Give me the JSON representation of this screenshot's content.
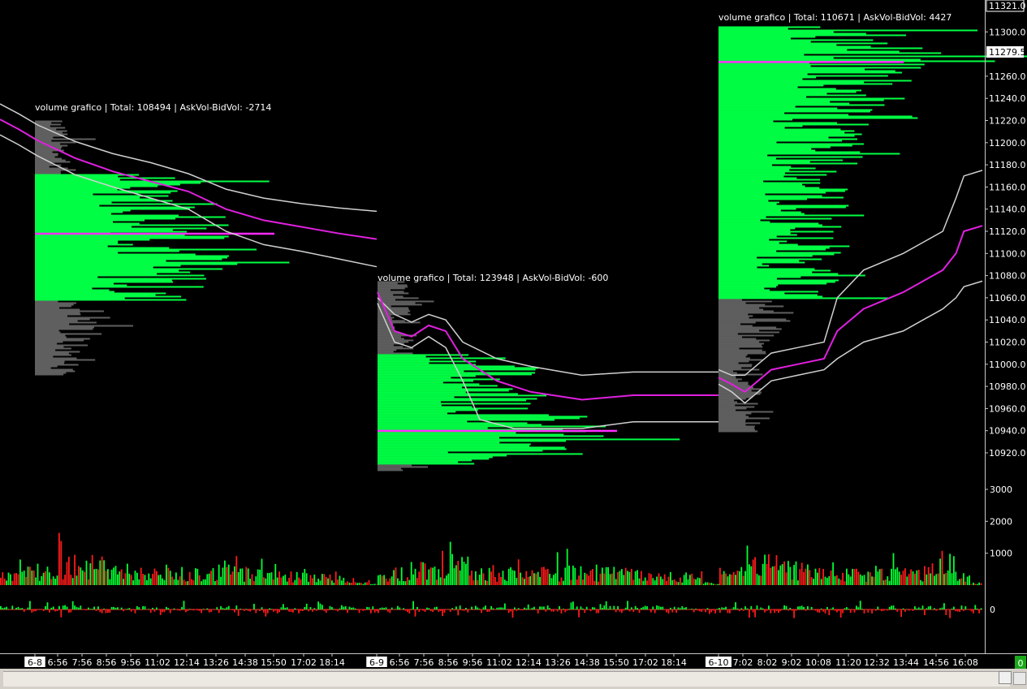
{
  "chart_data": {
    "type": "volume_profile",
    "price_axis": {
      "ticks": [
        10920,
        10940,
        10960,
        10980,
        11000,
        11020,
        11040,
        11060,
        11080,
        11100,
        11120,
        11140,
        11160,
        11180,
        11200,
        11220,
        11240,
        11260,
        11300
      ],
      "tick_labels": [
        "10920.0",
        "10940.0",
        "10960.0",
        "10980.0",
        "11000.0",
        "11020.0",
        "11040.0",
        "11060.0",
        "11080.0",
        "11100.0",
        "11120.0",
        "11140.0",
        "11160.0",
        "11180.0",
        "11200.0",
        "11220.0",
        "11240.0",
        "11260.0",
        "11300.0"
      ],
      "current_price_label": "11279.5",
      "top_price_label": "11321.0",
      "range": [
        10905,
        11325
      ]
    },
    "volume_axis": {
      "ticks": [
        1000,
        2000,
        3000
      ],
      "tick_labels": [
        "1000",
        "2000",
        "3000"
      ],
      "range": [
        0,
        3000
      ]
    },
    "delta_axis": {
      "ticks": [
        0
      ],
      "tick_labels": [
        "0"
      ]
    },
    "time_axis": [
      {
        "label": "6-8",
        "boxed": true
      },
      {
        "label": "6:56"
      },
      {
        "label": "7:56"
      },
      {
        "label": "8:56"
      },
      {
        "label": "9:56"
      },
      {
        "label": "11:02"
      },
      {
        "label": "12:14"
      },
      {
        "label": "13:26"
      },
      {
        "label": "14:38"
      },
      {
        "label": "15:50"
      },
      {
        "label": "17:02"
      },
      {
        "label": "18:14"
      },
      {
        "label": "6-9",
        "boxed": true
      },
      {
        "label": "6:56"
      },
      {
        "label": "7:56"
      },
      {
        "label": "8:56"
      },
      {
        "label": "9:56"
      },
      {
        "label": "11:02"
      },
      {
        "label": "12:14"
      },
      {
        "label": "13:26"
      },
      {
        "label": "14:38"
      },
      {
        "label": "15:50"
      },
      {
        "label": "17:02"
      },
      {
        "label": "18:14"
      },
      {
        "label": "6-10",
        "boxed": true
      },
      {
        "label": "7:02"
      },
      {
        "label": "8:02"
      },
      {
        "label": "9:02"
      },
      {
        "label": "10:08"
      },
      {
        "label": "11:20"
      },
      {
        "label": "12:32"
      },
      {
        "label": "13:44"
      },
      {
        "label": "14:56"
      },
      {
        "label": "16:08"
      }
    ],
    "sessions": [
      {
        "label": "volume grafico | Total: 108494 | AskVol-BidVol: -2714",
        "profile_high": 11220,
        "profile_low": 10990,
        "value_area_high": 11173,
        "value_area_low": 11058,
        "poc": 11118,
        "band_mid": [
          [
            0,
            11221
          ],
          [
            0.05,
            11212
          ],
          [
            0.1,
            11202
          ],
          [
            0.2,
            11186
          ],
          [
            0.3,
            11174
          ],
          [
            0.4,
            11165
          ],
          [
            0.5,
            11156
          ],
          [
            0.6,
            11140
          ],
          [
            0.7,
            11130
          ],
          [
            0.8,
            11124
          ],
          [
            0.9,
            11118
          ],
          [
            1,
            11113
          ]
        ],
        "band_upper": [
          [
            0,
            11235
          ],
          [
            0.05,
            11226
          ],
          [
            0.1,
            11216
          ],
          [
            0.2,
            11201
          ],
          [
            0.3,
            11190
          ],
          [
            0.4,
            11182
          ],
          [
            0.5,
            11172
          ],
          [
            0.6,
            11158
          ],
          [
            0.7,
            11150
          ],
          [
            0.8,
            11145
          ],
          [
            0.9,
            11141
          ],
          [
            1,
            11138
          ]
        ],
        "band_lower": [
          [
            0,
            11207
          ],
          [
            0.05,
            11198
          ],
          [
            0.1,
            11188
          ],
          [
            0.2,
            11171
          ],
          [
            0.3,
            11160
          ],
          [
            0.4,
            11150
          ],
          [
            0.5,
            11140
          ],
          [
            0.6,
            11120
          ],
          [
            0.7,
            11108
          ],
          [
            0.8,
            11102
          ],
          [
            0.9,
            11095
          ],
          [
            1,
            11088
          ]
        ]
      },
      {
        "label": "volume grafico | Total: 123948 | AskVol-BidVol: -600",
        "profile_high": 11075,
        "profile_low": 10905,
        "value_area_high": 11010,
        "value_area_low": 10910,
        "poc": 10940,
        "band_mid": [
          [
            0,
            11065
          ],
          [
            0.05,
            11030
          ],
          [
            0.1,
            11025
          ],
          [
            0.15,
            11035
          ],
          [
            0.2,
            11030
          ],
          [
            0.25,
            11005
          ],
          [
            0.35,
            10985
          ],
          [
            0.45,
            10975
          ],
          [
            0.6,
            10968
          ],
          [
            0.75,
            10972
          ],
          [
            1,
            10972
          ]
        ],
        "band_upper": [
          [
            0,
            11060
          ],
          [
            0.05,
            11045
          ],
          [
            0.1,
            11038
          ],
          [
            0.15,
            11045
          ],
          [
            0.2,
            11040
          ],
          [
            0.25,
            11020
          ],
          [
            0.35,
            11005
          ],
          [
            0.45,
            10998
          ],
          [
            0.6,
            10990
          ],
          [
            0.75,
            10993
          ],
          [
            1,
            10993
          ]
        ],
        "band_lower": [
          [
            0,
            11055
          ],
          [
            0.05,
            11020
          ],
          [
            0.1,
            11015
          ],
          [
            0.15,
            11025
          ],
          [
            0.2,
            11015
          ],
          [
            0.25,
            10985
          ],
          [
            0.3,
            10950
          ],
          [
            0.4,
            10942
          ],
          [
            0.6,
            10942
          ],
          [
            0.75,
            10948
          ],
          [
            1,
            10948
          ]
        ]
      },
      {
        "label": "volume grafico | Total: 110671 | AskVol-BidVol: 4427",
        "profile_high": 11305,
        "profile_low": 10940,
        "value_area_high": 11305,
        "value_area_low": 11060,
        "poc": 11273,
        "band_mid": [
          [
            0,
            10988
          ],
          [
            0.05,
            10982
          ],
          [
            0.1,
            10975
          ],
          [
            0.2,
            10995
          ],
          [
            0.3,
            11000
          ],
          [
            0.4,
            11005
          ],
          [
            0.45,
            11030
          ],
          [
            0.55,
            11050
          ],
          [
            0.7,
            11065
          ],
          [
            0.85,
            11085
          ],
          [
            0.9,
            11100
          ],
          [
            0.93,
            11120
          ],
          [
            1,
            11125
          ]
        ],
        "band_upper": [
          [
            0,
            10995
          ],
          [
            0.05,
            10990
          ],
          [
            0.1,
            10990
          ],
          [
            0.2,
            11010
          ],
          [
            0.3,
            11015
          ],
          [
            0.4,
            11020
          ],
          [
            0.45,
            11060
          ],
          [
            0.55,
            11085
          ],
          [
            0.7,
            11100
          ],
          [
            0.85,
            11120
          ],
          [
            0.9,
            11150
          ],
          [
            0.93,
            11170
          ],
          [
            1,
            11175
          ]
        ],
        "band_lower": [
          [
            0,
            10982
          ],
          [
            0.05,
            10975
          ],
          [
            0.1,
            10965
          ],
          [
            0.2,
            10985
          ],
          [
            0.3,
            10990
          ],
          [
            0.4,
            10995
          ],
          [
            0.45,
            11005
          ],
          [
            0.55,
            11020
          ],
          [
            0.7,
            11030
          ],
          [
            0.85,
            11050
          ],
          [
            0.9,
            11060
          ],
          [
            0.93,
            11070
          ],
          [
            1,
            11075
          ]
        ]
      }
    ],
    "colors": {
      "ask": "#00ff33",
      "bid": "#ff1a1a",
      "profile_value_area": "#00ff44",
      "profile_outside": "#5f5f5f",
      "poc": "#ff2bff",
      "band_mid": "#e020e0",
      "band_outer": "#d0d0d0",
      "current_price_box": "#ffffff"
    },
    "grid": false
  },
  "status": {
    "indicator_value": "0"
  }
}
